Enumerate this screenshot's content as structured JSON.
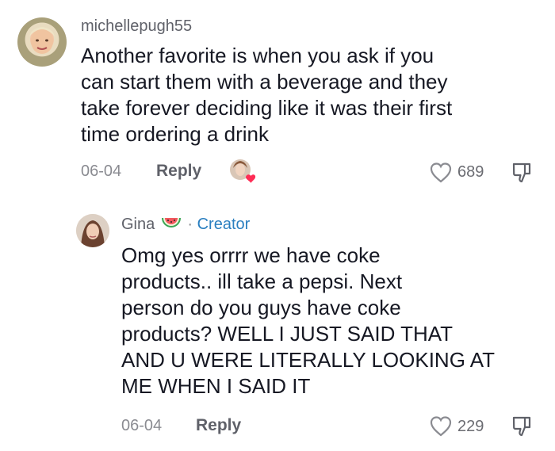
{
  "comments": [
    {
      "username": "michellepugh55",
      "lines": [
        "Another favorite is when you ask if you",
        "can start them with a beverage and they",
        "take forever deciding like it was their first",
        "time ordering a drink"
      ],
      "date": "06-04",
      "reply_label": "Reply",
      "likes": "689"
    },
    {
      "username": "Gina",
      "creator_label": "Creator",
      "separator": "·",
      "lines": [
        "Omg yes orrrr we have coke",
        "products.. ill take a pepsi. Next",
        "person do you guys have coke",
        "products? WELL I JUST SAID THAT",
        "AND U WERE LITERALLY LOOKING AT",
        "ME WHEN I SAID IT"
      ],
      "date": "06-04",
      "reply_label": "Reply",
      "likes": "229"
    }
  ],
  "icons": {
    "heart": "heart-outline-icon",
    "dislike": "thumbs-down-icon",
    "creator_liked": "creator-liked-avatar",
    "watermelon": "watermelon-emoji"
  },
  "colors": {
    "like_heart": "#fe2c55",
    "creator": "#2a7fc0"
  }
}
